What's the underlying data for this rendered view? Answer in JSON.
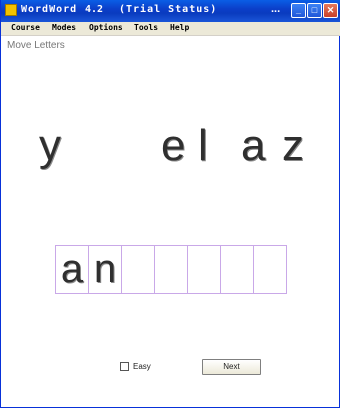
{
  "window": {
    "title_app": "WordWord",
    "title_version": "4.2",
    "title_status": "(Trial Status)",
    "title_dots": "...",
    "minimize_glyph": "_",
    "maximize_glyph": "□",
    "close_glyph": "✕"
  },
  "menu": [
    "Course",
    "Modes",
    "Options",
    "Tools",
    "Help"
  ],
  "page": {
    "heading": "Move Letters"
  },
  "scrambled_letters": [
    "y",
    "e",
    "l",
    "a",
    "z"
  ],
  "answer_slots": [
    "a",
    "n",
    "",
    "",
    "",
    "",
    ""
  ],
  "controls": {
    "easy_label": "Easy",
    "easy_checked": false,
    "next_label": "Next"
  }
}
